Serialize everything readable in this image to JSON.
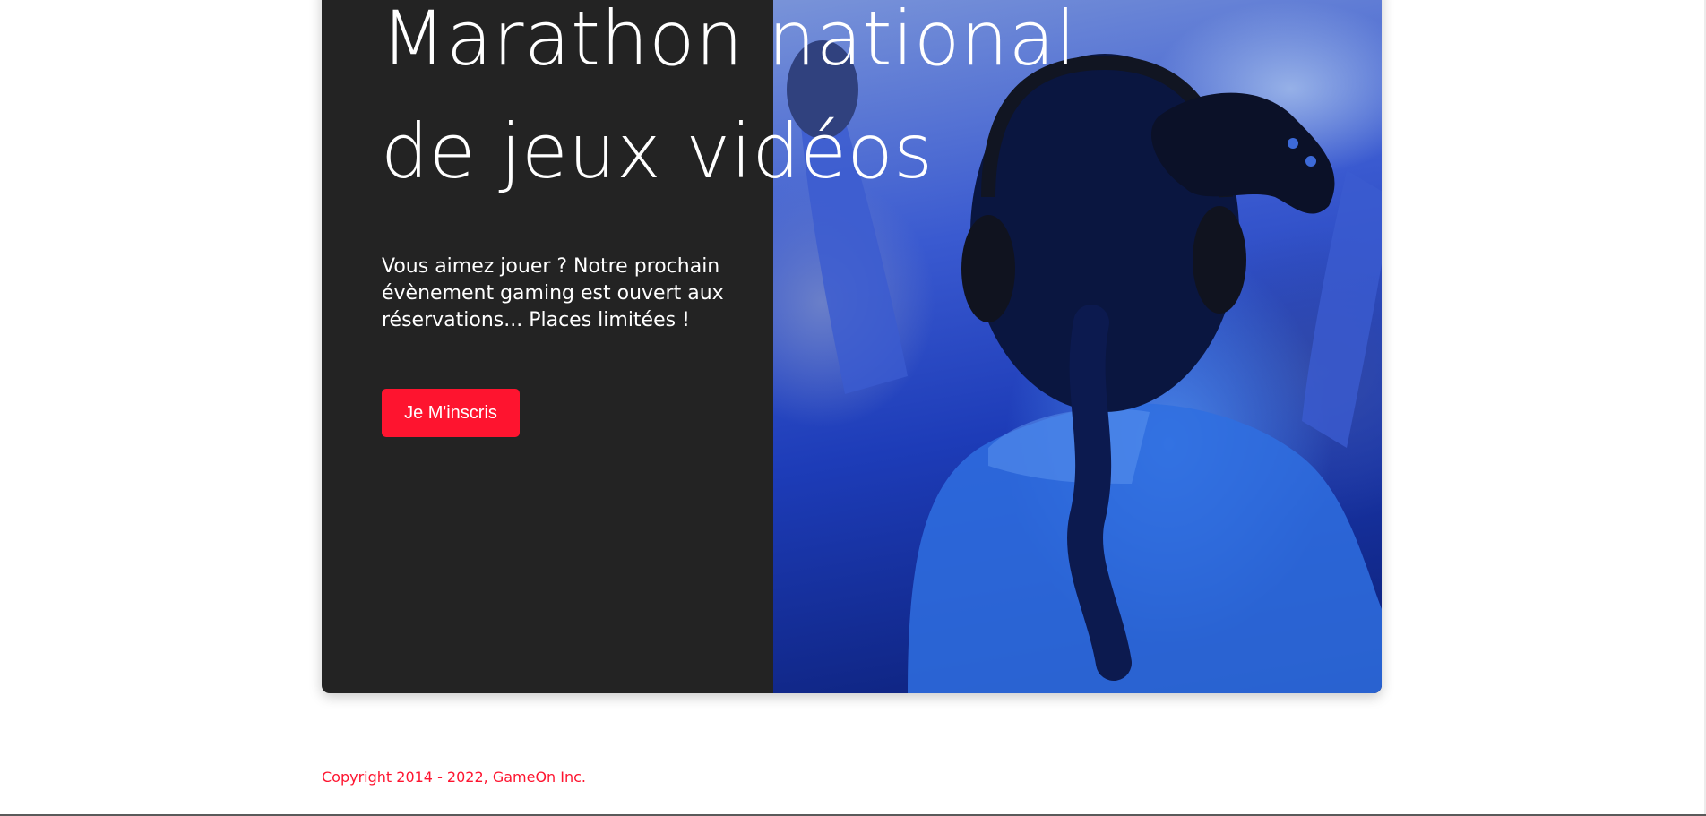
{
  "hero": {
    "title_line1": "Marathon national",
    "title_line2": "de jeux vidéos",
    "description": "Vous aimez jouer ? Notre prochain évènement gaming est ouvert aux réservations... Places limitées !",
    "cta_label": "Je M'inscris",
    "image_icon": "gamer-photo"
  },
  "footer": {
    "copyright": "Copyright 2014 - 2022, GameOn Inc."
  },
  "colors": {
    "accent": "#fe142f",
    "card_background": "#232323",
    "text_on_dark": "#ffffff"
  }
}
